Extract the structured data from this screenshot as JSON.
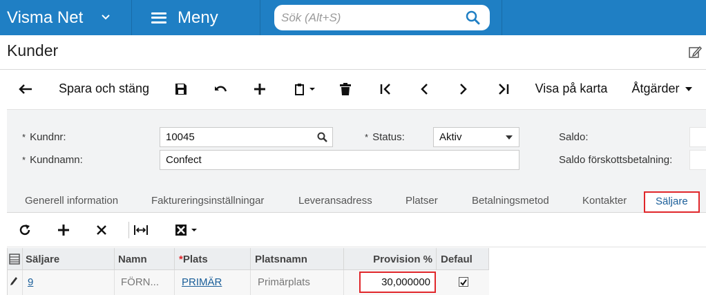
{
  "app": {
    "brand": "Visma Net",
    "menu_label": "Meny",
    "search_placeholder": "Sök (Alt+S)"
  },
  "page": {
    "title": "Kunder"
  },
  "toolbar": {
    "save_close": "Spara och stäng",
    "show_map": "Visa på karta",
    "actions": "Åtgärder"
  },
  "form": {
    "customer_no_label": "Kundnr:",
    "customer_no_value": "10045",
    "customer_name_label": "Kundnamn:",
    "customer_name_value": "Confect",
    "status_label": "Status:",
    "status_value": "Aktiv",
    "balance_label": "Saldo:",
    "prepayment_balance_label": "Saldo förskottsbetalning:"
  },
  "tabs": [
    {
      "label": "Generell information"
    },
    {
      "label": "Faktureringsinställningar"
    },
    {
      "label": "Leveransadress"
    },
    {
      "label": "Platser"
    },
    {
      "label": "Betalningsmetod"
    },
    {
      "label": "Kontakter"
    },
    {
      "label": "Säljare"
    }
  ],
  "grid": {
    "headers": [
      "Säljare",
      "Namn",
      "Plats",
      "Platsnamn",
      "Provision %",
      "Defaul"
    ],
    "rows": [
      {
        "seller": "9",
        "name": "FÖRN...",
        "location": "PRIMÄR",
        "location_name": "Primärplats",
        "commission": "30,000000",
        "default": true
      }
    ]
  },
  "colors": {
    "topbar": "#1f7fc4",
    "highlight": "#e0262a",
    "link": "#1a5e99"
  }
}
